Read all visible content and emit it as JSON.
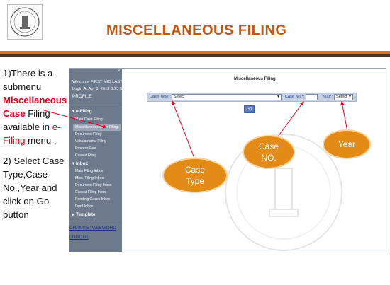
{
  "slide": {
    "title": "MISCELLANEOUS FILING",
    "instructions": {
      "step1_a": "1)There is a submenu ",
      "step1_menu": "Miscellaneous Case",
      "step1_b": " Filing available in ",
      "step1_efiling": "e-Filing",
      "step1_c": " menu .",
      "step2": "2) Select Case Type,Case No.,Year and click on Go button"
    }
  },
  "sidebar": {
    "welcome": "Welcome FIRST MID LAST",
    "login": "Login At:Apr 8, 2013 3:23:58 PM",
    "profile": "PROFILE",
    "efiling_header": "e-Filing",
    "efiling_items": [
      "Main Case Filing",
      "Miscellaneous Case Filing",
      "Document Filing",
      "Vakalatnama Filing",
      "Process Fee",
      "Caveat Filing"
    ],
    "inbox_header": "Inbox",
    "inbox_items": [
      "Main Filing Inbox",
      "Misc. Filing Inbox",
      "Document Filing Inbox",
      "Caveat Filing Inbox",
      "Pending Cases Inbox",
      "Draft Inbox"
    ],
    "template_header": "Template",
    "change_password": "CHANGE PASSWORD",
    "logout": "LOGOUT"
  },
  "form": {
    "title": "Miscellaneous Filing",
    "case_type_label": "Case Type*:",
    "case_type_value": "Select",
    "case_no_label": "Case No.*:",
    "case_no_value": "",
    "year_label": "Year*:",
    "year_value": "Select",
    "go_label": "Go"
  },
  "callouts": {
    "case_type": "Case Type",
    "case_no": "Case NO.",
    "year": "Year"
  },
  "colors": {
    "title": "#c6550f",
    "callout": "#e38a17",
    "sidebar": "#6c7a8c",
    "highlight_red": "#e0001b"
  }
}
